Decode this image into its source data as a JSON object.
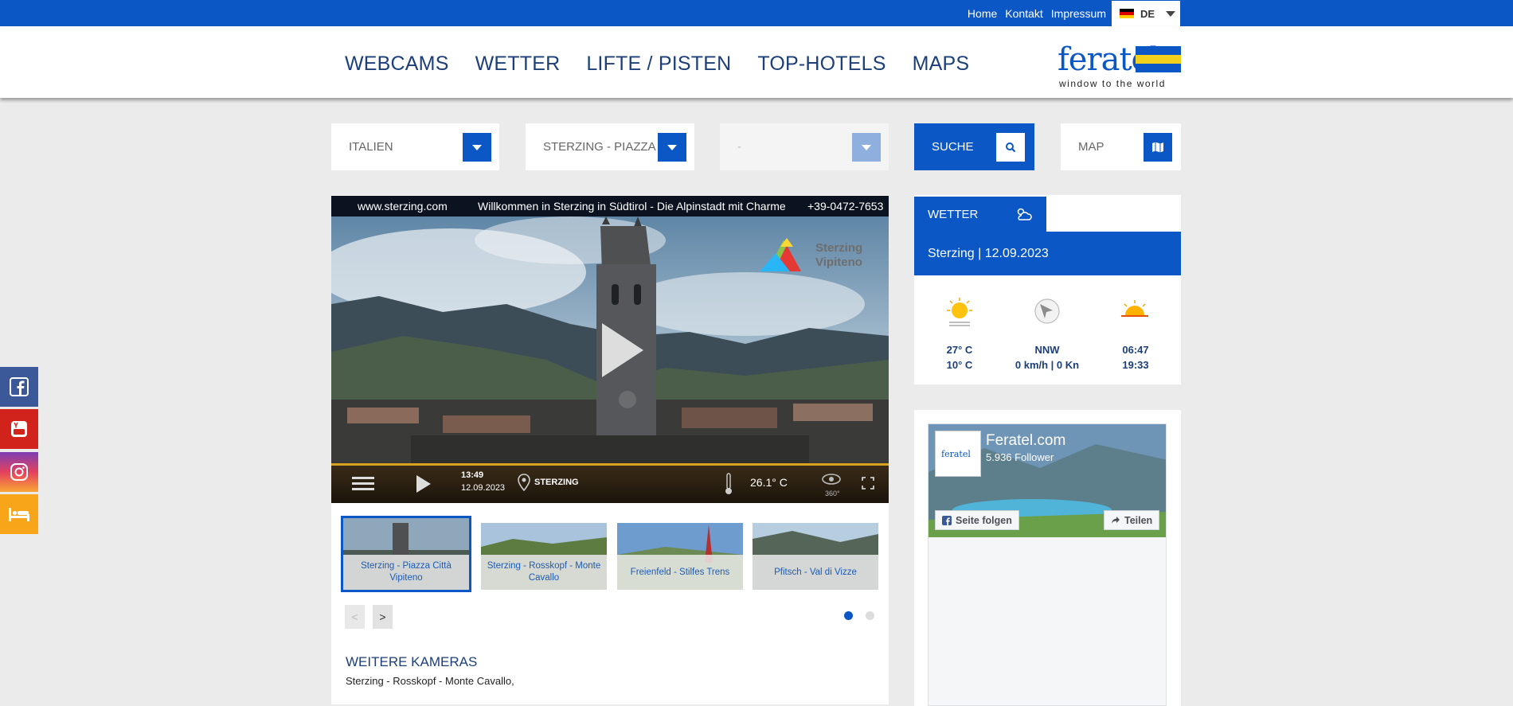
{
  "top_links": {
    "home": "Home",
    "kontakt": "Kontakt",
    "impressum": "Impressum"
  },
  "language": {
    "code": "DE",
    "flag_colors": [
      "#000000",
      "#dd0000",
      "#ffce00"
    ]
  },
  "logo": {
    "word": "feratel",
    "tagline": "window to the world",
    "flag_colors": [
      "#0b57c5",
      "#f2d11c"
    ]
  },
  "nav": {
    "webcams": "WEBCAMS",
    "wetter": "WETTER",
    "lifte": "LIFTE / PISTEN",
    "hotels": "TOP-HOTELS",
    "maps": "MAPS"
  },
  "filters": {
    "country": "ITALIEN",
    "location": "STERZING - PIAZZA",
    "sub": "-",
    "search": "SUCHE",
    "map": "MAP"
  },
  "video": {
    "header_site": "www.sterzing.com",
    "header_text": "Willkommen in Sterzing in Südtirol - Die Alpinstadt mit Charme",
    "header_phone": "+39-0472-7653",
    "brand_line1": "Sterzing",
    "brand_line2": "Vipiteno",
    "time": "13:49",
    "date": "12.09.2023",
    "place": "STERZING",
    "temperature": "26.1° C",
    "pano_label": "360°"
  },
  "thumbnails": [
    {
      "caption": "Sterzing - Piazza Città Vipiteno",
      "active": true
    },
    {
      "caption": "Sterzing - Rosskopf - Monte Cavallo",
      "active": false
    },
    {
      "caption": "Freienfeld - Stilfes Trens",
      "active": false
    },
    {
      "caption": "Pfitsch - Val di Vizze",
      "active": false
    }
  ],
  "pager": {
    "prev": "<",
    "next": ">"
  },
  "more_cameras": {
    "title": "WEITERE KAMERAS",
    "list": "Sterzing - Rosskopf - Monte Cavallo,"
  },
  "weather": {
    "tab": "WETTER",
    "place_date": "Sterzing | 12.09.2023",
    "temp_max": "27° C",
    "temp_min": "10° C",
    "wind_dir": "NNW",
    "wind_speed": "0 km/h | 0 Kn",
    "sunrise": "06:47",
    "sunset": "19:33"
  },
  "facebook": {
    "page_name": "Feratel.com",
    "followers": "5.936 Follower",
    "follow": "Seite folgen",
    "share": "Teilen",
    "avatar_word": "feratel"
  },
  "social": [
    {
      "name": "facebook",
      "color": "#3b5998"
    },
    {
      "name": "youtube",
      "color": "#d2221c"
    },
    {
      "name": "instagram",
      "color": "#c13584"
    },
    {
      "name": "hotel",
      "color": "#f9a51a"
    }
  ]
}
